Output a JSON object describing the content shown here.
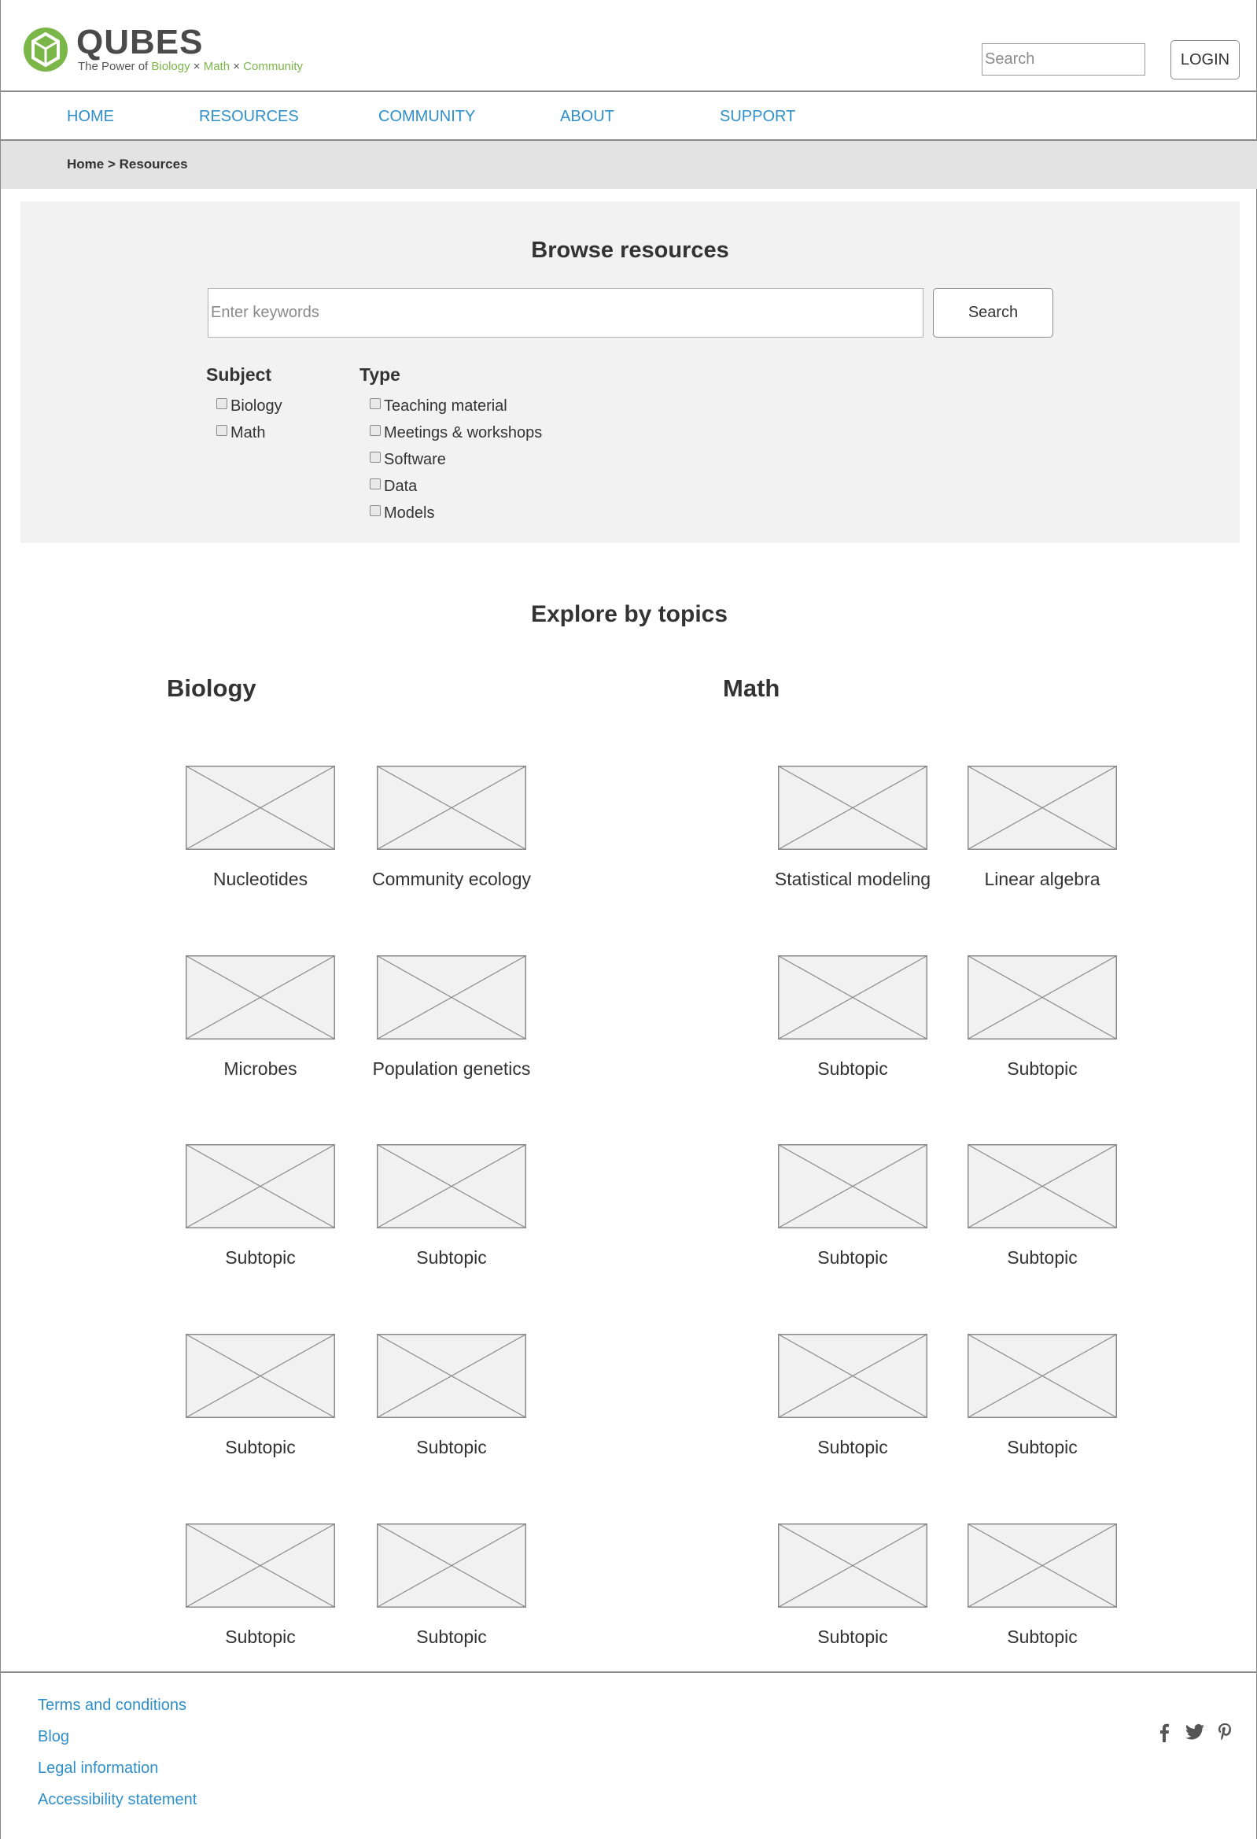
{
  "header": {
    "logo_name": "QUBES",
    "tagline_prefix": "The Power of ",
    "tagline_word1": "Biology",
    "tagline_sep1": " × ",
    "tagline_word2": "Math",
    "tagline_sep2": " × ",
    "tagline_word3": "Community",
    "search_placeholder": "Search",
    "login_label": "LOGIN"
  },
  "nav": {
    "items": [
      "HOME",
      "RESOURCES",
      "COMMUNITY",
      "ABOUT",
      "SUPPORT"
    ]
  },
  "breadcrumb": "Home > Resources",
  "browse": {
    "title": "Browse resources",
    "keywords_placeholder": "Enter keywords",
    "search_label": "Search",
    "subject": {
      "heading": "Subject",
      "options": [
        "Biology",
        "Math"
      ]
    },
    "type": {
      "heading": "Type",
      "options": [
        "Teaching material",
        "Meetings & workshops",
        "Software",
        "Data",
        "Models"
      ]
    }
  },
  "topics": {
    "title": "Explore by topics",
    "biology": {
      "heading": "Biology",
      "items": [
        "Nucleotides",
        "Community ecology",
        "Microbes",
        "Population genetics",
        "Subtopic",
        "Subtopic",
        "Subtopic",
        "Subtopic",
        "Subtopic",
        "Subtopic"
      ]
    },
    "math": {
      "heading": "Math",
      "items": [
        "Statistical modeling",
        "Linear algebra",
        "Subtopic",
        "Subtopic",
        "Subtopic",
        "Subtopic",
        "Subtopic",
        "Subtopic",
        "Subtopic",
        "Subtopic"
      ]
    }
  },
  "footer": {
    "links": [
      "Terms and conditions",
      "Blog",
      "Legal information",
      "Accessibility statement"
    ],
    "social": {
      "facebook_glyph": "f",
      "twitter_glyph": "🐦",
      "pinterest_glyph": "P"
    }
  },
  "colors": {
    "link": "#2f8fc8",
    "brand_green": "#7ab648",
    "panel": "#f2f2f2",
    "crumb_bar": "#e3e3e3"
  }
}
